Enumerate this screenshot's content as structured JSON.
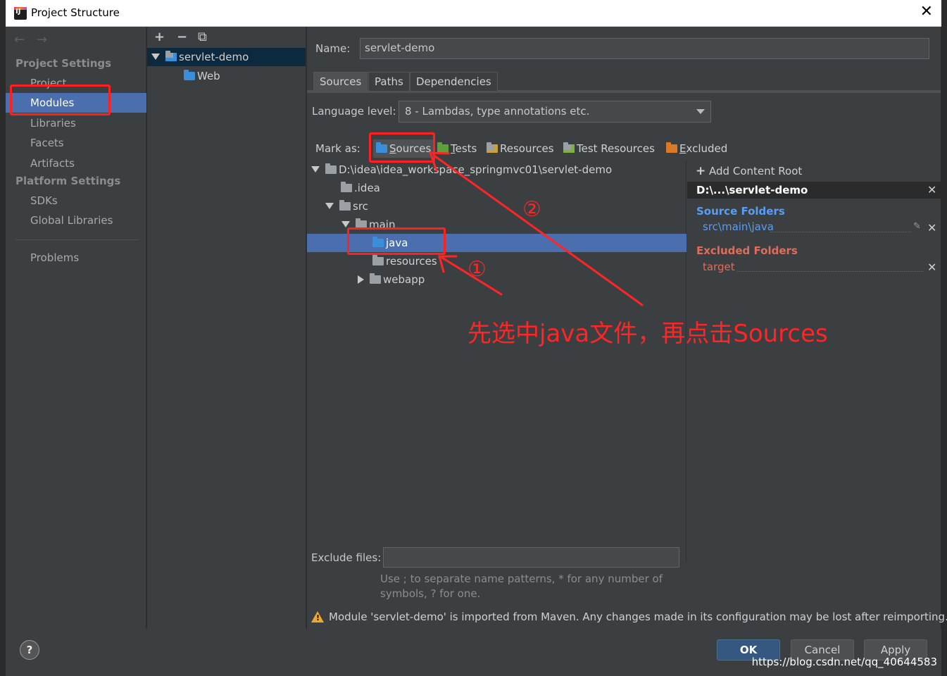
{
  "window": {
    "title": "Project Structure",
    "close_glyph": "✕"
  },
  "nav": {
    "back": "←",
    "forward": "→",
    "project_settings": "Project Settings",
    "items_project": [
      "Project",
      "Modules",
      "Libraries",
      "Facets",
      "Artifacts"
    ],
    "platform_settings": "Platform Settings",
    "items_platform": [
      "SDKs",
      "Global Libraries"
    ],
    "problems": "Problems",
    "selected": "Modules"
  },
  "module_tree": {
    "toolbar": {
      "add": "+",
      "remove": "−",
      "copy": "⧉"
    },
    "items": [
      {
        "label": "servlet-demo",
        "icon": "module-folder-icon"
      },
      {
        "label": "Web",
        "icon": "web-facet-icon"
      }
    ]
  },
  "main": {
    "name_label": "Name:",
    "name_value": "servlet-demo",
    "tabs": [
      "Sources",
      "Paths",
      "Dependencies"
    ],
    "active_tab": "Sources",
    "language_level_label": "Language level:",
    "language_level_value": "8 - Lambdas, type annotations etc.",
    "mark_as_label": "Mark as:",
    "mark_as": [
      {
        "label": "Sources",
        "icon": "sources-folder-icon",
        "mnemonic": "S",
        "rest": "ources"
      },
      {
        "label": "Tests",
        "icon": "tests-folder-icon",
        "mnemonic": "T",
        "rest": "ests"
      },
      {
        "label": "Resources",
        "icon": "resources-folder-icon"
      },
      {
        "label": "Test Resources",
        "icon": "test-resources-folder-icon"
      },
      {
        "label": "Excluded",
        "icon": "excluded-folder-icon",
        "mnemonic": "E",
        "rest": "xcluded"
      }
    ],
    "content_tree": [
      "D:\\idea\\idea_workspace_springmvc01\\servlet-demo",
      ".idea",
      "src",
      "main",
      "java",
      "resources",
      "webapp"
    ],
    "content_tree_selected": "java",
    "add_content_root": "Add Content Root",
    "add_content_root_mnemonic": "C",
    "root_path": "D:\\...\\servlet-demo",
    "source_folders_title": "Source Folders",
    "source_folders": [
      "src\\main\\java"
    ],
    "excluded_folders_title": "Excluded Folders",
    "excluded_folders": [
      "target"
    ],
    "exclude_files_label": "Exclude files:",
    "exclude_files_value": "",
    "hint_line1": "Use ; to separate name patterns, * for any number of",
    "hint_line2": "symbols, ? for one.",
    "warning": "Module 'servlet-demo' is imported from Maven. Any changes made in its configuration may be lost after reimporting."
  },
  "buttons": {
    "help": "?",
    "ok": "OK",
    "cancel": "Cancel",
    "apply": "Apply"
  },
  "watermark": "https://blog.csdn.net/qq_40644583",
  "annotations": {
    "instruction": "先选中java文件，再点击Sources",
    "step1": "①",
    "step2": "②"
  },
  "colors": {
    "selection": "#4b6eaf",
    "source_blue": "#589df6",
    "excluded_red": "#e06c5b",
    "annotation_red": "#ff2525"
  }
}
